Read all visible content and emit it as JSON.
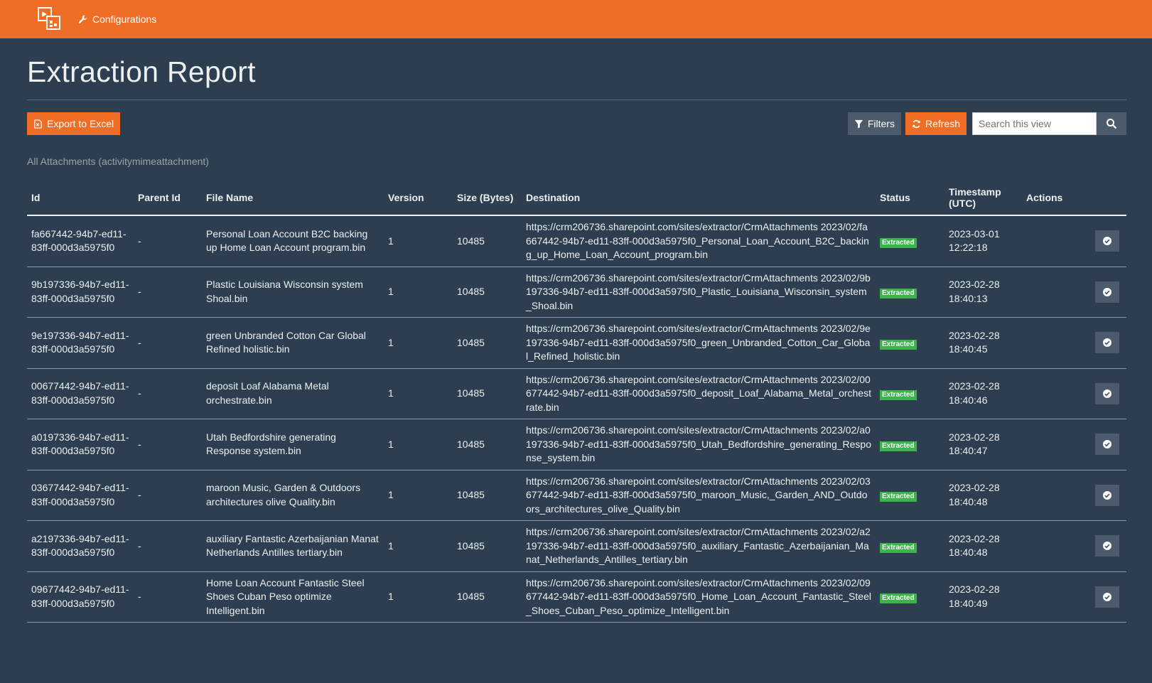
{
  "header": {
    "nav_label": "Configurations",
    "logo_icon": "app-logo-icon",
    "nav_icon": "wrench-icon"
  },
  "page": {
    "title": "Extraction Report"
  },
  "toolbar": {
    "export_label": "Export to Excel",
    "filters_label": "Filters",
    "refresh_label": "Refresh",
    "search_placeholder": "Search this view"
  },
  "view": {
    "subtitle": "All Attachments (activitymimeattachment)"
  },
  "table": {
    "columns": [
      "Id",
      "Parent Id",
      "File Name",
      "Version",
      "Size (Bytes)",
      "Destination",
      "Status",
      "Timestamp (UTC)",
      "Actions"
    ],
    "rows": [
      {
        "id": "fa667442-94b7-ed11-83ff-000d3a5975f0",
        "parent": "-",
        "file": "Personal Loan Account B2C backing up Home Loan Account program.bin",
        "version": "1",
        "size": "10485",
        "dest": "https://crm206736.sharepoint.com/sites/extractor/CrmAttachments 2023/02/fa667442-94b7-ed11-83ff-000d3a5975f0_Personal_Loan_Account_B2C_backing_up_Home_Loan_Account_program.bin",
        "status": "Extracted",
        "date": "2023-03-01",
        "time": "12:22:18"
      },
      {
        "id": "9b197336-94b7-ed11-83ff-000d3a5975f0",
        "parent": "-",
        "file": "Plastic Louisiana Wisconsin system Shoal.bin",
        "version": "1",
        "size": "10485",
        "dest": "https://crm206736.sharepoint.com/sites/extractor/CrmAttachments 2023/02/9b197336-94b7-ed11-83ff-000d3a5975f0_Plastic_Louisiana_Wisconsin_system_Shoal.bin",
        "status": "Extracted",
        "date": "2023-02-28",
        "time": "18:40:13"
      },
      {
        "id": "9e197336-94b7-ed11-83ff-000d3a5975f0",
        "parent": "-",
        "file": "green Unbranded Cotton Car Global Refined holistic.bin",
        "version": "1",
        "size": "10485",
        "dest": "https://crm206736.sharepoint.com/sites/extractor/CrmAttachments 2023/02/9e197336-94b7-ed11-83ff-000d3a5975f0_green_Unbranded_Cotton_Car_Global_Refined_holistic.bin",
        "status": "Extracted",
        "date": "2023-02-28",
        "time": "18:40:45"
      },
      {
        "id": "00677442-94b7-ed11-83ff-000d3a5975f0",
        "parent": "-",
        "file": "deposit Loaf Alabama Metal orchestrate.bin",
        "version": "1",
        "size": "10485",
        "dest": "https://crm206736.sharepoint.com/sites/extractor/CrmAttachments 2023/02/00677442-94b7-ed11-83ff-000d3a5975f0_deposit_Loaf_Alabama_Metal_orchestrate.bin",
        "status": "Extracted",
        "date": "2023-02-28",
        "time": "18:40:46"
      },
      {
        "id": "a0197336-94b7-ed11-83ff-000d3a5975f0",
        "parent": "-",
        "file": "Utah Bedfordshire generating Response system.bin",
        "version": "1",
        "size": "10485",
        "dest": "https://crm206736.sharepoint.com/sites/extractor/CrmAttachments 2023/02/a0197336-94b7-ed11-83ff-000d3a5975f0_Utah_Bedfordshire_generating_Response_system.bin",
        "status": "Extracted",
        "date": "2023-02-28",
        "time": "18:40:47"
      },
      {
        "id": "03677442-94b7-ed11-83ff-000d3a5975f0",
        "parent": "-",
        "file": "maroon Music, Garden & Outdoors architectures olive Quality.bin",
        "version": "1",
        "size": "10485",
        "dest": "https://crm206736.sharepoint.com/sites/extractor/CrmAttachments 2023/02/03677442-94b7-ed11-83ff-000d3a5975f0_maroon_Music,_Garden_AND_Outdoors_architectures_olive_Quality.bin",
        "status": "Extracted",
        "date": "2023-02-28",
        "time": "18:40:48"
      },
      {
        "id": "a2197336-94b7-ed11-83ff-000d3a5975f0",
        "parent": "-",
        "file": "auxiliary Fantastic Azerbaijanian Manat Netherlands Antilles tertiary.bin",
        "version": "1",
        "size": "10485",
        "dest": "https://crm206736.sharepoint.com/sites/extractor/CrmAttachments 2023/02/a2197336-94b7-ed11-83ff-000d3a5975f0_auxiliary_Fantastic_Azerbaijanian_Manat_Netherlands_Antilles_tertiary.bin",
        "status": "Extracted",
        "date": "2023-02-28",
        "time": "18:40:48"
      },
      {
        "id": "09677442-94b7-ed11-83ff-000d3a5975f0",
        "parent": "-",
        "file": "Home Loan Account Fantastic Steel Shoes Cuban Peso optimize Intelligent.bin",
        "version": "1",
        "size": "10485",
        "dest": "https://crm206736.sharepoint.com/sites/extractor/CrmAttachments 2023/02/09677442-94b7-ed11-83ff-000d3a5975f0_Home_Loan_Account_Fantastic_Steel_Shoes_Cuban_Peso_optimize_Intelligent.bin",
        "status": "Extracted",
        "date": "2023-02-28",
        "time": "18:40:49"
      }
    ]
  },
  "colors": {
    "header": "#f06d25",
    "background": "#2c3e50",
    "status_extracted": "#3cb44b",
    "button_gray": "#4b5b6b"
  }
}
